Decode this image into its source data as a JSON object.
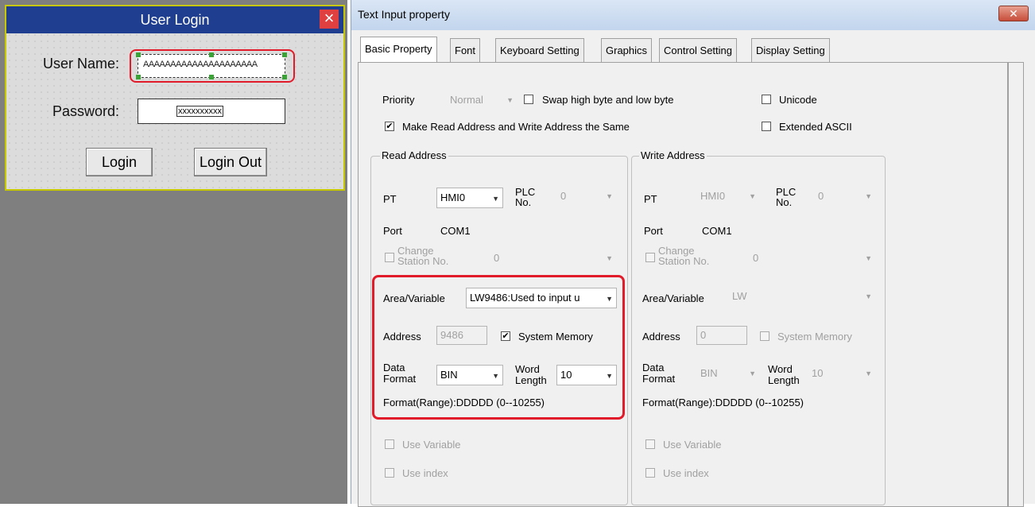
{
  "login": {
    "title": "User Login",
    "user_name_label": "User Name:",
    "user_name_value": "AAAAAAAAAAAAAAAAAAAAA",
    "password_label": "Password:",
    "password_value": "xxxxxxxxxx",
    "login_button": "Login",
    "logout_button": "Login Out"
  },
  "dialog": {
    "title": "Text Input property",
    "close_glyph": "✕",
    "tabs": [
      "Basic Property",
      "Font",
      "Keyboard Setting",
      "Graphics",
      "Control Setting",
      "Display Setting"
    ],
    "priority_label": "Priority",
    "priority_value": "Normal",
    "swap_label": "Swap high byte and low byte",
    "unicode_label": "Unicode",
    "same_address_label": "Make Read Address and Write Address the Same",
    "extended_ascii_label": "Extended ASCII",
    "read": {
      "group_title": "Read Address",
      "pt_label": "PT",
      "pt_value": "HMI0",
      "plc_label": "PLC No.",
      "plc_value": "0",
      "port_label": "Port",
      "port_value": "COM1",
      "change_station_label": "Change Station No.",
      "change_station_value": "0",
      "area_label": "Area/Variable",
      "area_value": "LW9486:Used to input u",
      "address_label": "Address",
      "address_value": "9486",
      "system_memory_label": "System Memory",
      "data_format_label": "Data Format",
      "data_format_value": "BIN",
      "word_length_label": "Word Length",
      "word_length_value": "10",
      "format_range": "Format(Range):DDDDD (0--10255)",
      "use_variable_label": "Use Variable",
      "use_index_label": "Use index"
    },
    "write": {
      "group_title": "Write Address",
      "pt_label": "PT",
      "pt_value": "HMI0",
      "plc_label": "PLC No.",
      "plc_value": "0",
      "port_label": "Port",
      "port_value": "COM1",
      "change_station_label": "Change Station No.",
      "change_station_value": "0",
      "area_label": "Area/Variable",
      "area_value": "LW",
      "address_label": "Address",
      "address_value": "0",
      "system_memory_label": "System Memory",
      "data_format_label": "Data Format",
      "data_format_value": "BIN",
      "word_length_label": "Word Length",
      "word_length_value": "10",
      "format_range": "Format(Range):DDDDD (0--10255)",
      "use_variable_label": "Use Variable",
      "use_index_label": "Use index"
    },
    "check_glyph": "✔",
    "arrow_glyph": "▼"
  },
  "colors": {
    "highlight": "#e21b2a",
    "title_bar": "#1f3e8f",
    "canvas": "#7f7f7f"
  }
}
